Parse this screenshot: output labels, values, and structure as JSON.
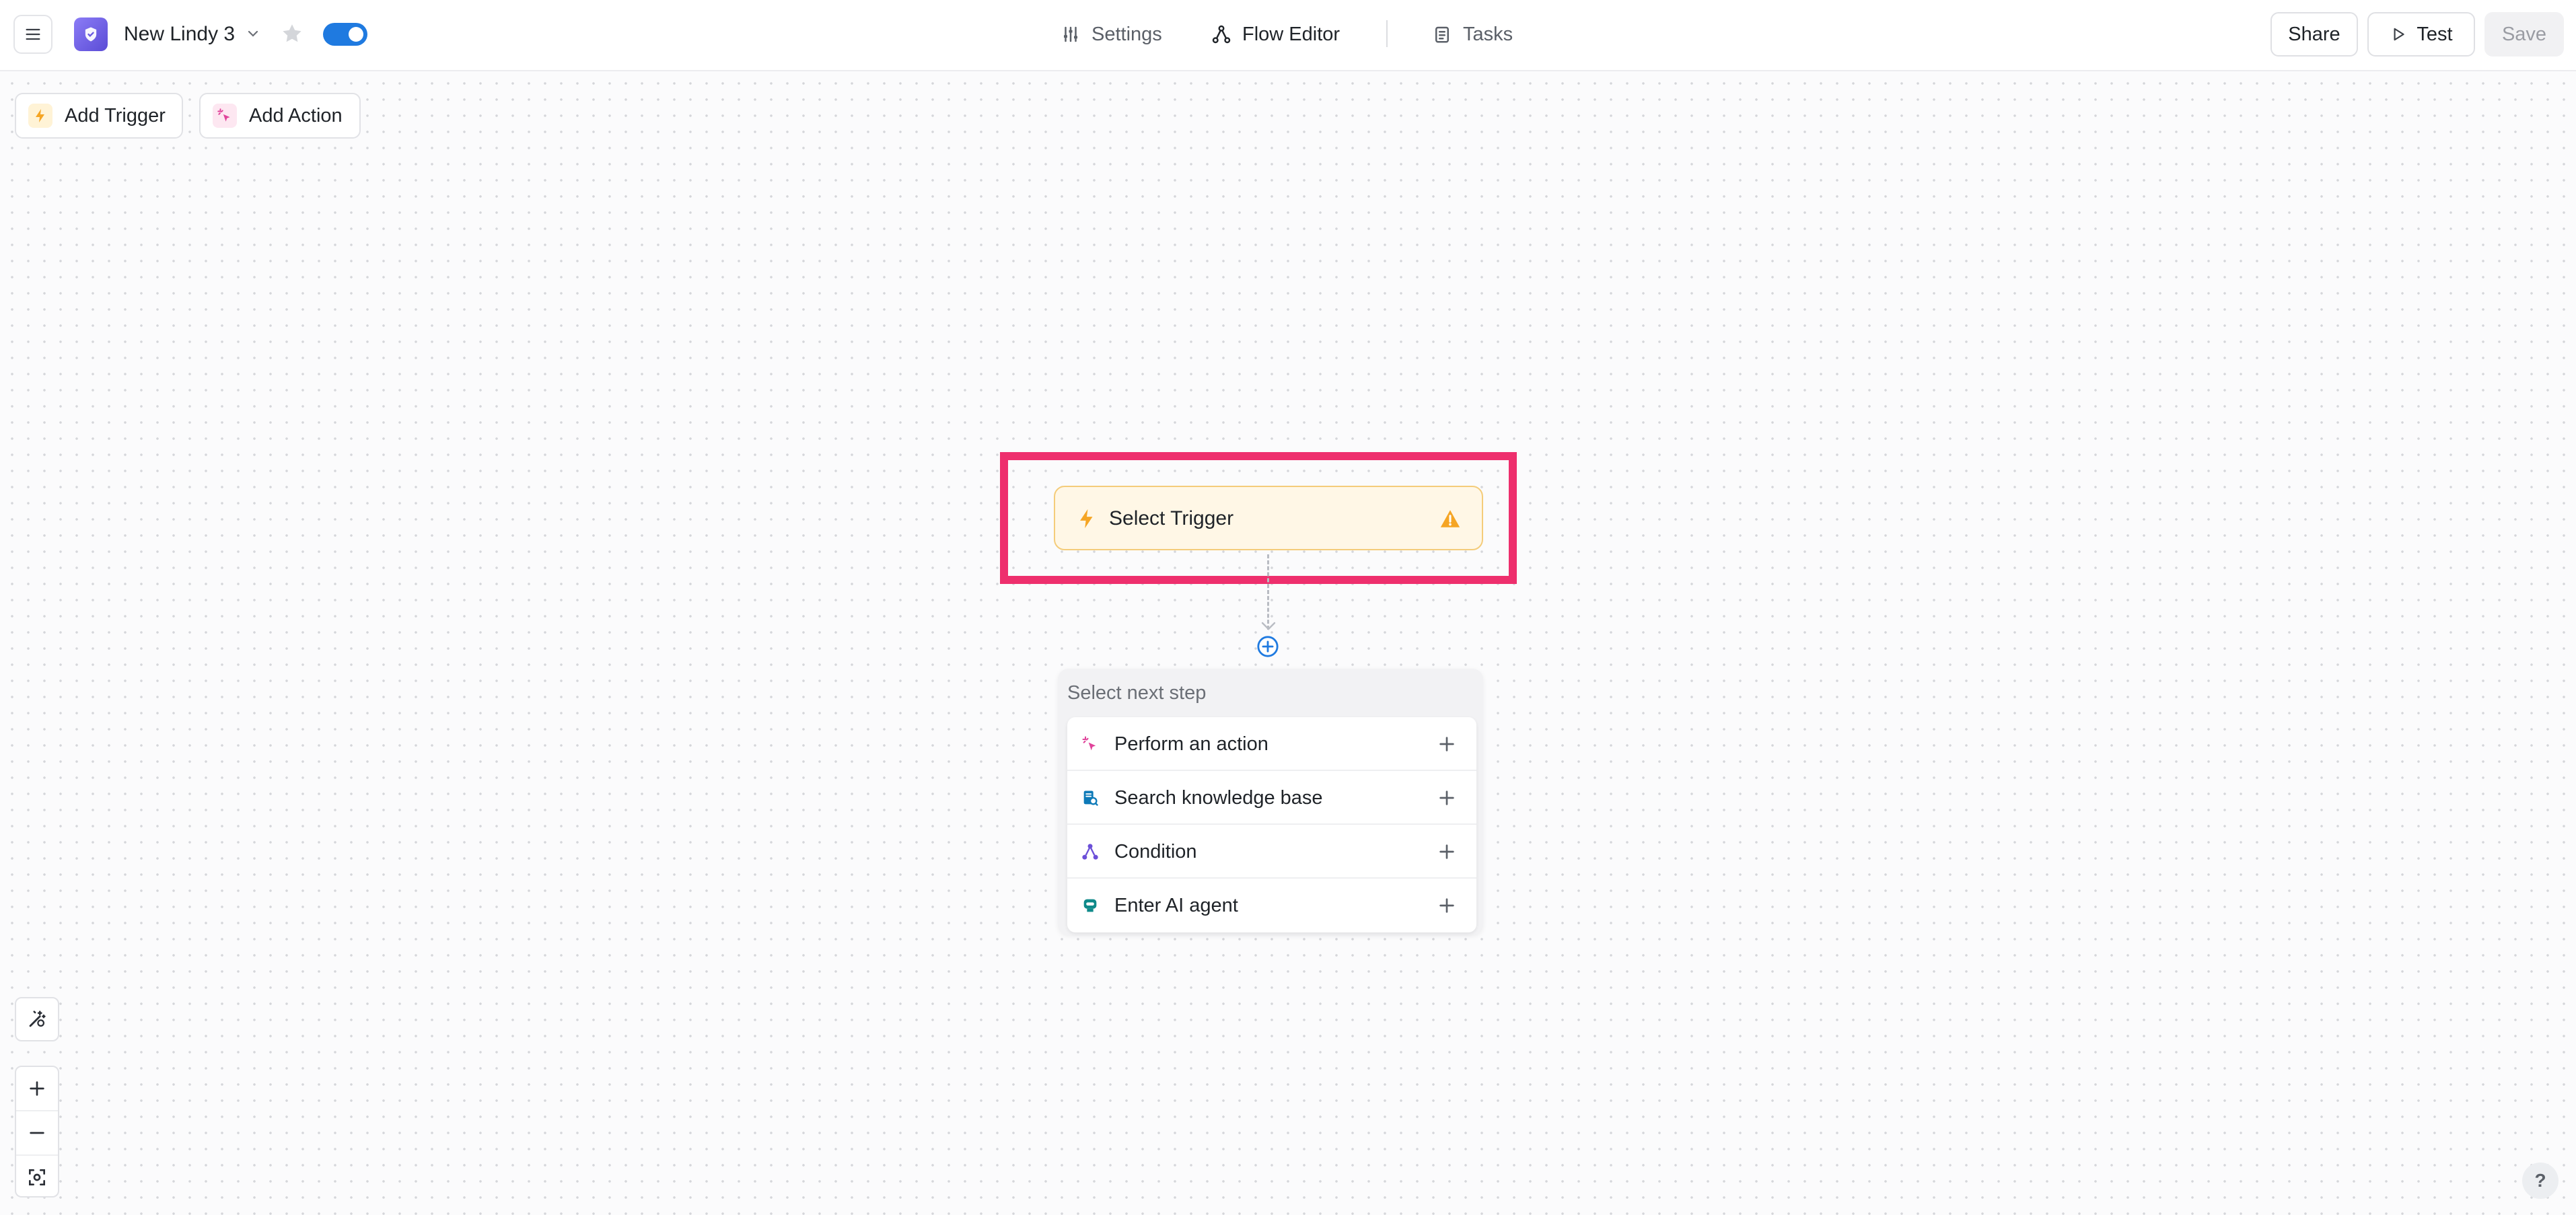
{
  "header": {
    "agent_name": "New Lindy 3",
    "enabled": true,
    "tabs": [
      {
        "label": "Settings",
        "icon": "sliders-icon",
        "active": false
      },
      {
        "label": "Flow Editor",
        "icon": "flow-icon",
        "active": true
      },
      {
        "label": "Tasks",
        "icon": "clipboard-icon",
        "active": false
      }
    ],
    "share_label": "Share",
    "test_label": "Test",
    "save_label": "Save"
  },
  "palette": {
    "add_trigger_label": "Add Trigger",
    "add_action_label": "Add Action"
  },
  "flow": {
    "trigger_label": "Select Trigger",
    "next_step_title": "Select next step",
    "next_steps": [
      {
        "label": "Perform an action",
        "icon": "sparkle-cursor-icon"
      },
      {
        "label": "Search knowledge base",
        "icon": "knowledge-base-icon"
      },
      {
        "label": "Condition",
        "icon": "condition-icon"
      },
      {
        "label": "Enter AI agent",
        "icon": "ai-agent-icon"
      }
    ]
  },
  "help": {
    "label": "?"
  },
  "colors": {
    "accent": "#1f7ae0",
    "highlight": "#ee2f6d",
    "trigger_bg": "#fff7e6",
    "trigger_icon": "#f5a524",
    "action_icon": "#e0439a"
  }
}
